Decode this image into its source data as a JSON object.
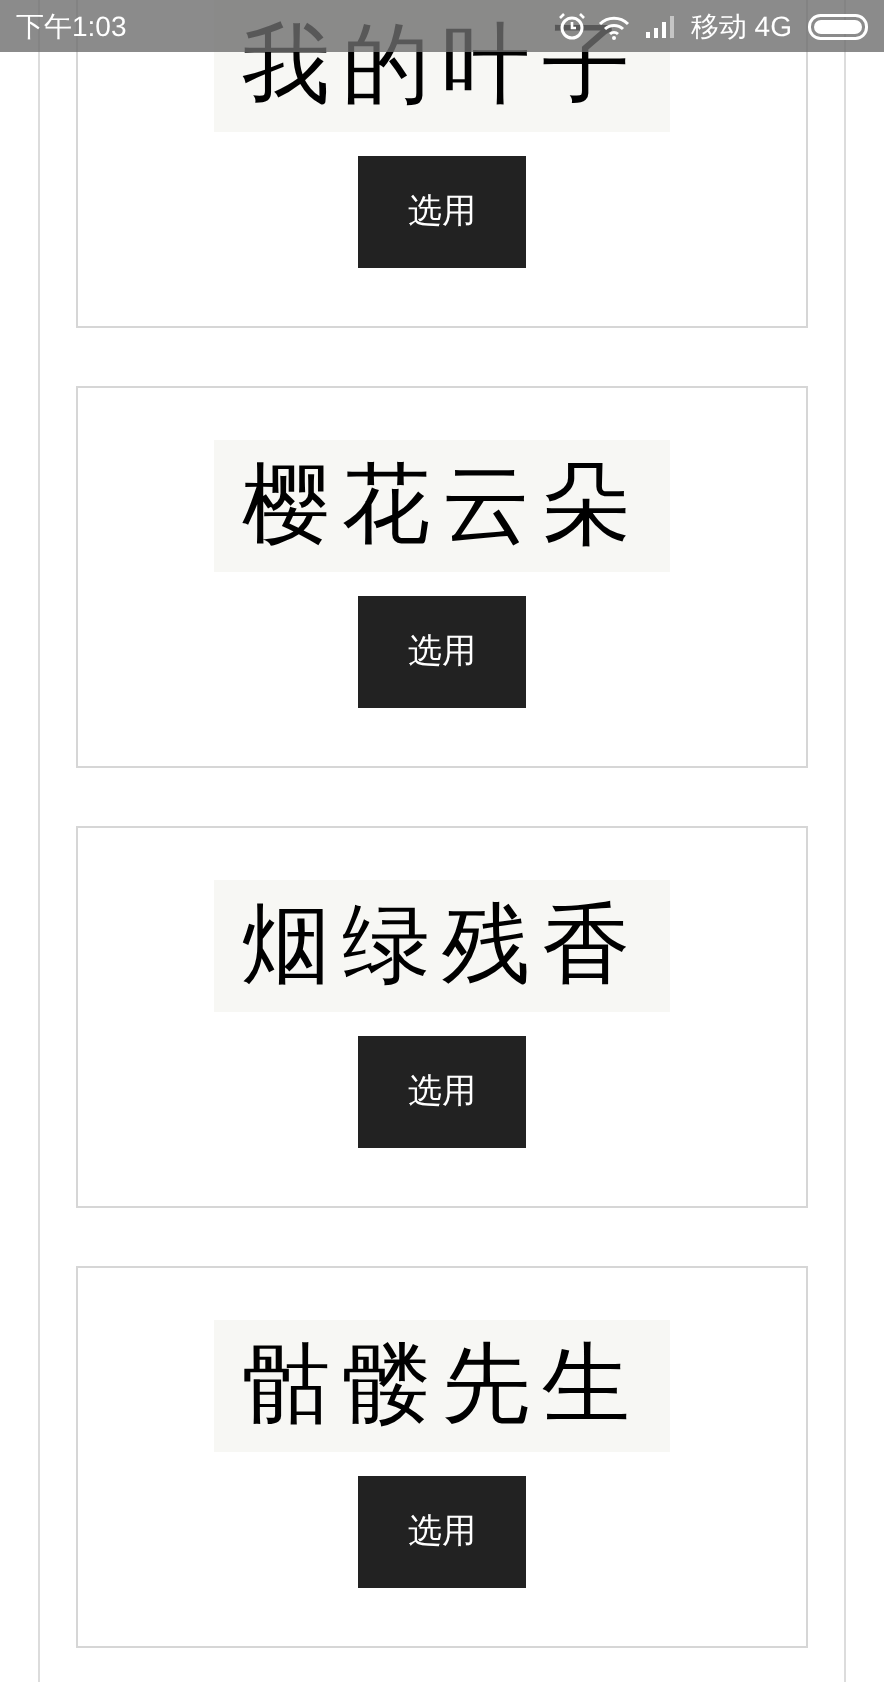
{
  "status_bar": {
    "time": "下午1:03",
    "carrier": "移动 4G"
  },
  "fonts": [
    {
      "preview": "我的叶子",
      "button": "选用"
    },
    {
      "preview": "樱花云朵",
      "button": "选用"
    },
    {
      "preview": "烟绿残香",
      "button": "选用"
    },
    {
      "preview": "骷髅先生",
      "button": "选用"
    }
  ]
}
